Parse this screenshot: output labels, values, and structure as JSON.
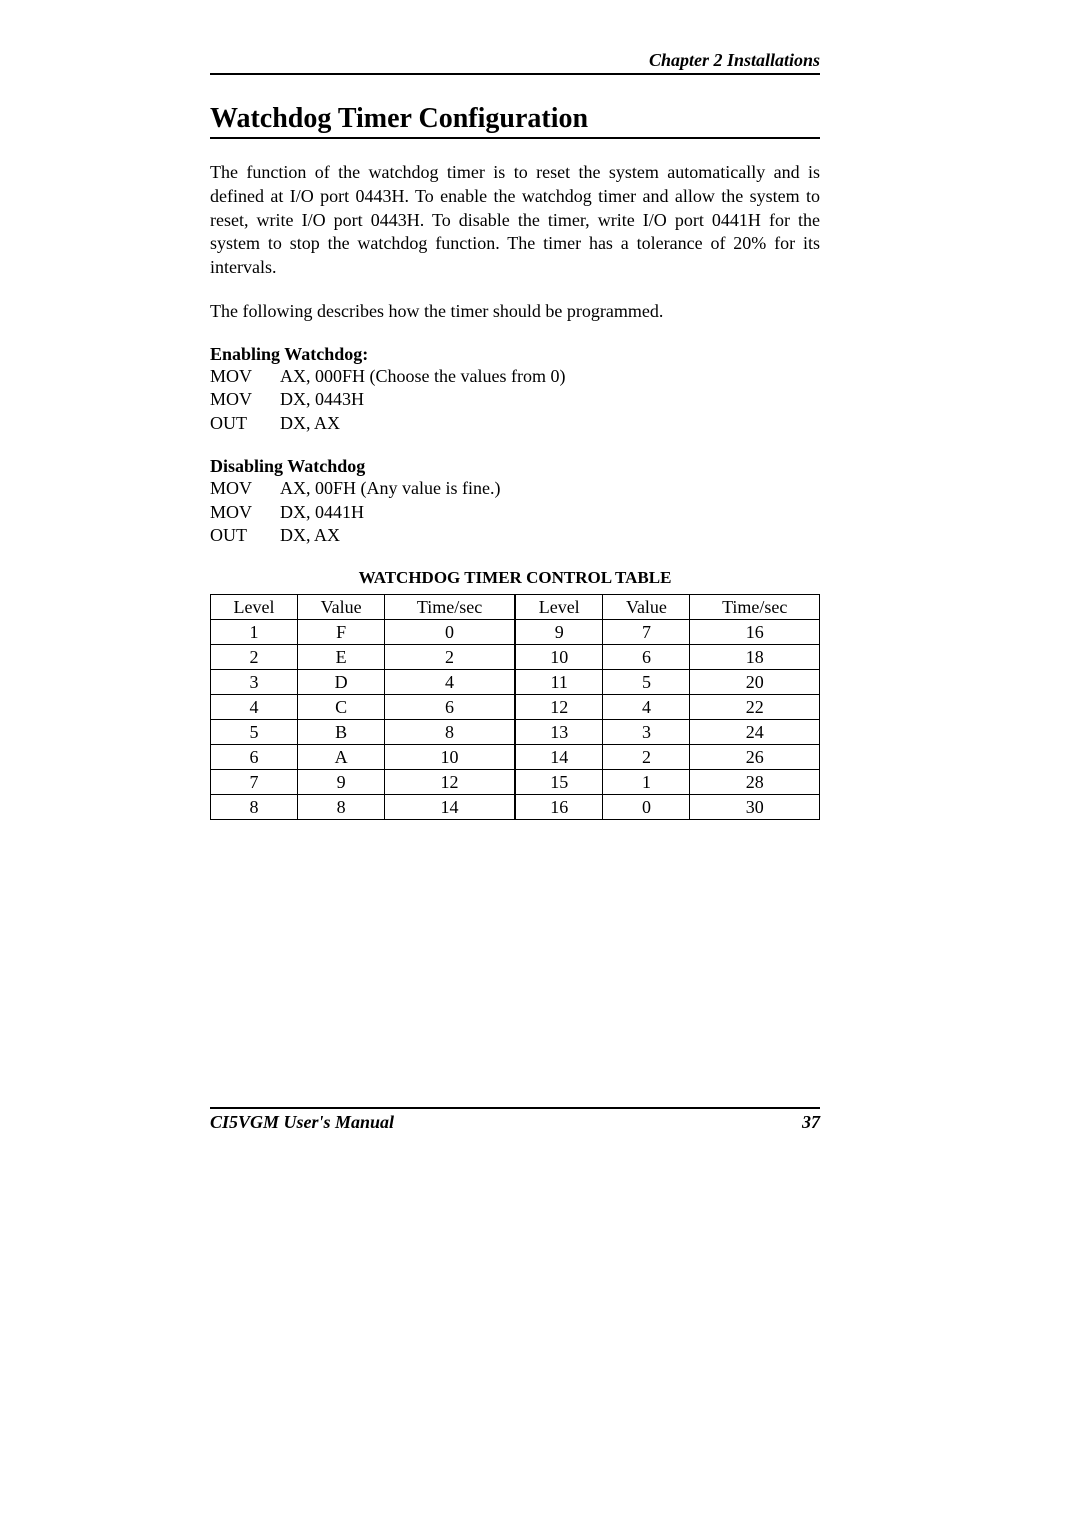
{
  "chapter_header": "Chapter 2  Installations",
  "section_title": "Watchdog Timer Configuration",
  "paragraph_1": "The function of the watchdog timer is to reset the system automatically and is defined at I/O port 0443H. To enable the watchdog timer and allow the system to reset, write I/O port 0443H. To disable the timer, write I/O port 0441H for the system to stop the watchdog function. The timer has a tolerance of 20% for its intervals.",
  "paragraph_2": "The following describes how the timer should be programmed.",
  "enable": {
    "heading": "Enabling Watchdog:",
    "lines": [
      {
        "op": "MOV",
        "arg": "AX, 000FH (Choose the values from 0)"
      },
      {
        "op": "MOV",
        "arg": "DX, 0443H"
      },
      {
        "op": "OUT",
        "arg": "DX, AX"
      }
    ]
  },
  "disable": {
    "heading": "Disabling Watchdog",
    "lines": [
      {
        "op": "MOV",
        "arg": "AX, 00FH (Any value is fine.)"
      },
      {
        "op": "MOV",
        "arg": "DX, 0441H"
      },
      {
        "op": "OUT",
        "arg": "DX, AX"
      }
    ]
  },
  "table_title": "WATCHDOG TIMER CONTROL TABLE",
  "table": {
    "headers": [
      "Level",
      "Value",
      "Time/sec",
      "Level",
      "Value",
      "Time/sec"
    ],
    "rows": [
      [
        "1",
        "F",
        "0",
        "9",
        "7",
        "16"
      ],
      [
        "2",
        "E",
        "2",
        "10",
        "6",
        "18"
      ],
      [
        "3",
        "D",
        "4",
        "11",
        "5",
        "20"
      ],
      [
        "4",
        "C",
        "6",
        "12",
        "4",
        "22"
      ],
      [
        "5",
        "B",
        "8",
        "13",
        "3",
        "24"
      ],
      [
        "6",
        "A",
        "10",
        "14",
        "2",
        "26"
      ],
      [
        "7",
        "9",
        "12",
        "15",
        "1",
        "28"
      ],
      [
        "8",
        "8",
        "14",
        "16",
        "0",
        "30"
      ]
    ]
  },
  "footer": {
    "manual": "CI5VGM User's Manual",
    "page": "37"
  }
}
